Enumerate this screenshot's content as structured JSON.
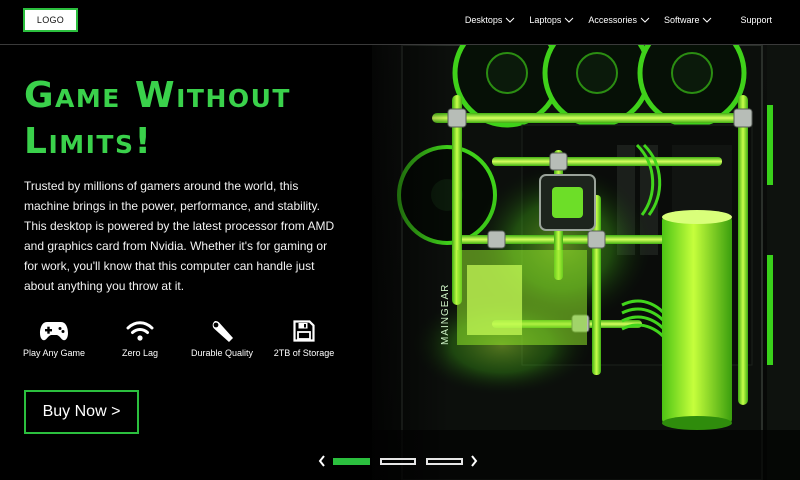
{
  "header": {
    "logo_text": "LOGO",
    "nav": [
      {
        "label": "Desktops",
        "has_dropdown": true,
        "icon": "chevron-down-icon"
      },
      {
        "label": "Laptops",
        "has_dropdown": true,
        "icon": "chevron-down-icon"
      },
      {
        "label": "Accessories",
        "has_dropdown": true,
        "icon": "chevron-down-icon"
      },
      {
        "label": "Software",
        "has_dropdown": true,
        "icon": "chevron-down-icon"
      },
      {
        "label": "Support",
        "has_dropdown": false
      }
    ]
  },
  "hero": {
    "headline": "Game Without Limits!",
    "description": "Trusted by millions of gamers around the world, this machine brings in the power, performance, and stability. This desktop is powered by the latest processor from AMD and graphics card from Nvidia. Whether it's for gaming or for work, you'll know that this computer can handle just about anything you throw at it.",
    "image_brand_text": "MAINGEAR",
    "features": [
      {
        "label": "Play Any Game",
        "icon": "gamepad-icon"
      },
      {
        "label": "Zero Lag",
        "icon": "wifi-icon"
      },
      {
        "label": "Durable Quality",
        "icon": "wrench-icon"
      },
      {
        "label": "2TB of Storage",
        "icon": "floppy-disk-icon"
      }
    ],
    "cta_label": "Buy Now >"
  },
  "carousel": {
    "slide_count": 3,
    "active_index": 0,
    "prev_icon": "chevron-left-icon",
    "next_icon": "chevron-right-icon"
  },
  "colors": {
    "accent": "#2bbf3e",
    "headline": "#3ad14b",
    "background": "#000000",
    "text": "#ffffff"
  }
}
